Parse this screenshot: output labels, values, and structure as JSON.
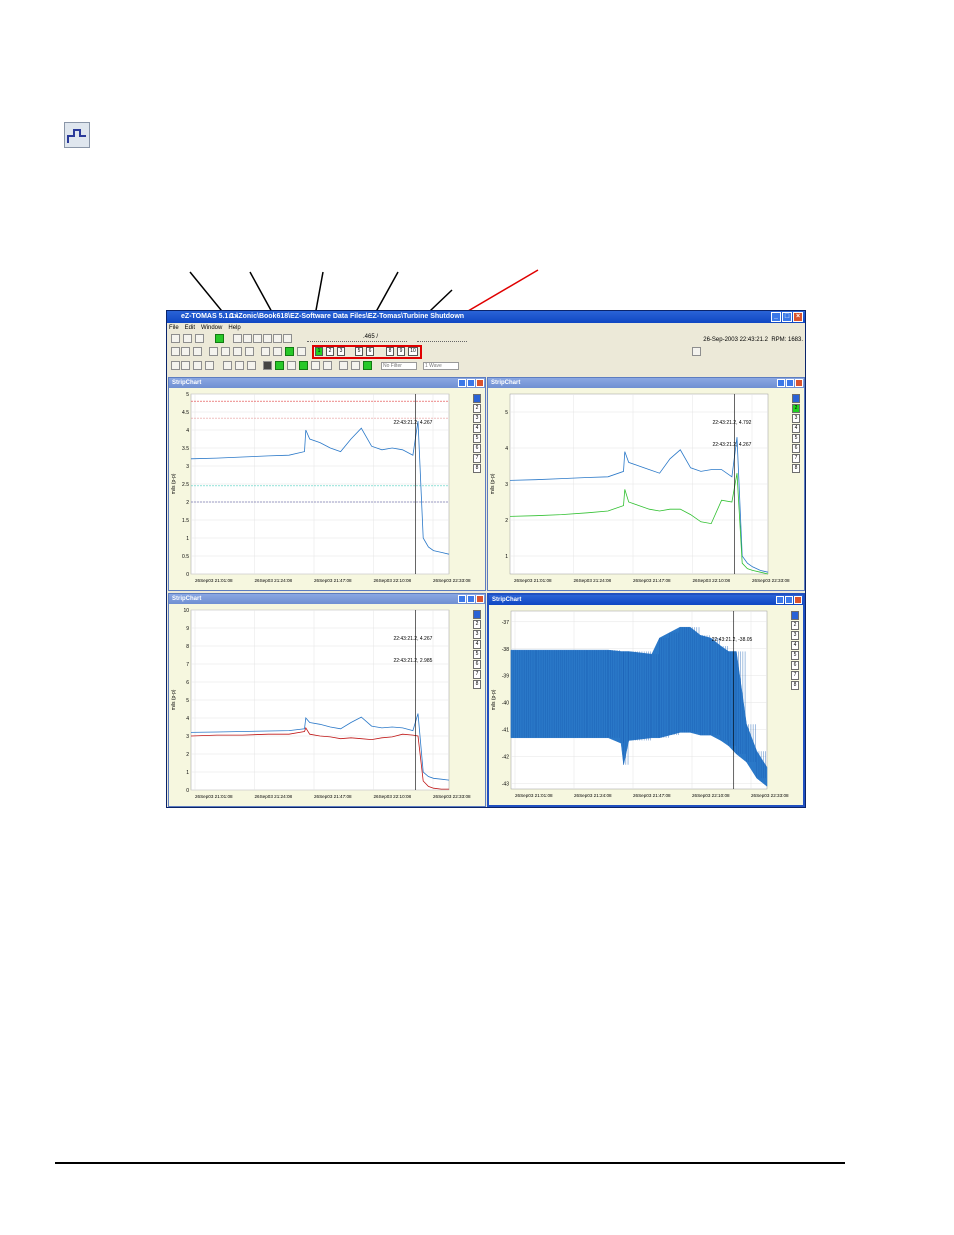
{
  "app": {
    "title": "eZ-TOMAS 5.1.1x",
    "path": "C:\\Zonic\\Book618\\EZ-Software Data Files\\EZ-Tomas\\Turbine Shutdown",
    "menu": [
      "File",
      "Edit",
      "Window",
      "Help"
    ],
    "timestamp": "26-Sep-2003 22:43:21.2",
    "rpm": "RPM: 1683.",
    "playback_value": ".465 /",
    "channels": [
      "1",
      "2",
      "3",
      "4",
      "5",
      "6",
      "7",
      "8",
      "9",
      "10"
    ],
    "filter_select": "No Filter",
    "wave_select": "1 Wave",
    "colors": {
      "accent": "#2a63d6",
      "highlight": "#e00000",
      "active_channel": "#1fd11f"
    }
  },
  "windows": [
    {
      "title": "StripChart",
      "channels": [
        "1",
        "2",
        "3",
        "4",
        "5",
        "6",
        "7",
        "8"
      ],
      "active": [
        1
      ]
    },
    {
      "title": "StripChart",
      "channels": [
        "1",
        "2",
        "3",
        "4",
        "5",
        "6",
        "7",
        "8"
      ],
      "active": [
        1,
        2
      ]
    },
    {
      "title": "StripChart",
      "channels": [
        "1",
        "2",
        "3",
        "4",
        "5",
        "6",
        "7",
        "8"
      ],
      "active": [
        1
      ]
    },
    {
      "title": "StripChart",
      "channels": [
        "1",
        "2",
        "3",
        "4",
        "5",
        "6",
        "7",
        "8"
      ],
      "active": [
        1
      ],
      "focused": true
    }
  ],
  "chart_data": [
    {
      "type": "line",
      "title": "StripChart",
      "xlabel": "",
      "ylabel": "mils (p-p)",
      "ylim": [
        0,
        5
      ],
      "yticks": [
        "0",
        "0.5",
        "1",
        "1.5",
        "2",
        "2.5",
        "3",
        "3.5",
        "4",
        "4.5",
        "5"
      ],
      "xticks": [
        "26Sep03 21:01:08",
        "26Sep03 21:24:08",
        "26Sep03 21:47:08",
        "26Sep03 22:10:08",
        "26Sep03 22:33:08"
      ],
      "cursor_label": "22:43:21.2, 4.267",
      "grid": true,
      "reference_lines": [
        {
          "y": 4.8,
          "color": "#e04040"
        },
        {
          "y": 4.33,
          "color": "#e08080"
        },
        {
          "y": 2.45,
          "color": "#50d0c0"
        },
        {
          "y": 2.0,
          "color": "#404090"
        }
      ],
      "series": [
        {
          "color": "#2a78c8",
          "x": [
            0,
            0.1,
            0.2,
            0.3,
            0.38,
            0.44,
            0.445,
            0.46,
            0.5,
            0.54,
            0.58,
            0.62,
            0.66,
            0.7,
            0.74,
            0.78,
            0.82,
            0.86,
            0.88,
            0.9,
            0.92,
            0.94,
            0.97,
            1.0
          ],
          "values": [
            3.2,
            3.22,
            3.25,
            3.28,
            3.3,
            3.4,
            4.0,
            3.75,
            3.65,
            3.5,
            3.4,
            3.75,
            4.05,
            3.55,
            3.45,
            3.5,
            3.45,
            3.3,
            4.25,
            1.0,
            0.75,
            0.65,
            0.6,
            0.55
          ]
        }
      ]
    },
    {
      "type": "line",
      "title": "StripChart",
      "xlabel": "",
      "ylabel": "mils (p-p)",
      "ylim": [
        0.5,
        5.5
      ],
      "yticks": [
        "1",
        "2",
        "3",
        "4",
        "5"
      ],
      "xticks": [
        "26Sep03 21:01:08",
        "26Sep03 21:24:08",
        "26Sep03 21:47:08",
        "26Sep03 22:10:08",
        "26Sep03 22:33:08"
      ],
      "cursor_labels": [
        "22:43:21.2, 4.792",
        "22:43:21.2, 4.267"
      ],
      "grid": true,
      "series": [
        {
          "color": "#2a78c8",
          "x": [
            0,
            0.1,
            0.2,
            0.3,
            0.38,
            0.44,
            0.445,
            0.46,
            0.5,
            0.54,
            0.58,
            0.62,
            0.66,
            0.7,
            0.74,
            0.78,
            0.82,
            0.86,
            0.88,
            0.9,
            0.92,
            0.94,
            0.97,
            1.0
          ],
          "values": [
            3.1,
            3.12,
            3.15,
            3.18,
            3.2,
            3.35,
            3.9,
            3.6,
            3.5,
            3.4,
            3.3,
            3.7,
            3.95,
            3.45,
            3.35,
            3.4,
            3.4,
            3.2,
            4.3,
            1.0,
            0.8,
            0.7,
            0.6,
            0.55
          ]
        },
        {
          "color": "#30c030",
          "x": [
            0,
            0.1,
            0.2,
            0.3,
            0.38,
            0.44,
            0.445,
            0.46,
            0.5,
            0.54,
            0.58,
            0.62,
            0.66,
            0.7,
            0.74,
            0.78,
            0.82,
            0.86,
            0.88,
            0.9,
            0.92,
            0.94,
            0.97,
            1.0
          ],
          "values": [
            2.1,
            2.12,
            2.15,
            2.2,
            2.25,
            2.4,
            2.85,
            2.5,
            2.4,
            2.3,
            2.25,
            2.3,
            2.3,
            2.15,
            1.95,
            1.9,
            2.55,
            2.5,
            3.3,
            0.8,
            0.65,
            0.6,
            0.55,
            0.5
          ]
        }
      ]
    },
    {
      "type": "line",
      "title": "StripChart",
      "xlabel": "",
      "ylabel": "mils (p-p)",
      "ylim": [
        0,
        10
      ],
      "yticks": [
        "0",
        "1",
        "2",
        "3",
        "4",
        "5",
        "6",
        "7",
        "8",
        "9",
        "10"
      ],
      "xticks": [
        "26Sep03 21:01:08",
        "26Sep03 21:24:08",
        "26Sep03 21:47:08",
        "26Sep03 22:10:08",
        "26Sep03 22:33:08"
      ],
      "cursor_labels": [
        "22:43:21.2, 4.267",
        "22:43:21.2, 2.985"
      ],
      "grid": true,
      "series": [
        {
          "color": "#2a78c8",
          "x": [
            0,
            0.1,
            0.2,
            0.3,
            0.38,
            0.44,
            0.445,
            0.46,
            0.5,
            0.54,
            0.58,
            0.62,
            0.66,
            0.7,
            0.74,
            0.78,
            0.82,
            0.86,
            0.88,
            0.9,
            0.92,
            0.94,
            0.97,
            1.0
          ],
          "values": [
            3.2,
            3.22,
            3.25,
            3.28,
            3.3,
            3.4,
            4.0,
            3.75,
            3.65,
            3.5,
            3.4,
            3.75,
            4.05,
            3.55,
            3.45,
            3.5,
            3.45,
            3.3,
            4.25,
            1.0,
            0.75,
            0.65,
            0.6,
            0.55
          ]
        },
        {
          "color": "#c01818",
          "x": [
            0,
            0.1,
            0.2,
            0.3,
            0.38,
            0.44,
            0.445,
            0.46,
            0.5,
            0.54,
            0.58,
            0.62,
            0.66,
            0.7,
            0.74,
            0.78,
            0.82,
            0.86,
            0.88,
            0.9,
            0.92,
            0.94,
            0.97,
            1.0
          ],
          "values": [
            3.0,
            3.05,
            3.05,
            3.1,
            3.1,
            3.25,
            3.45,
            3.1,
            3.0,
            2.95,
            2.85,
            2.9,
            2.85,
            2.8,
            2.9,
            2.95,
            3.1,
            3.05,
            3.0,
            0.5,
            0.2,
            0.1,
            0.05,
            0.05
          ]
        }
      ]
    },
    {
      "type": "line",
      "title": "StripChart",
      "xlabel": "",
      "ylabel": "mils (p-p)",
      "ylim": [
        -43.2,
        -36.6
      ],
      "yticks": [
        "-43",
        "-42",
        "-41",
        "-40",
        "-39",
        "-38",
        "-37"
      ],
      "xticks": [
        "26Sep03 21:01:08",
        "26Sep03 21:24:08",
        "26Sep03 21:47:08",
        "26Sep03 22:10:08",
        "26Sep03 22:33:08"
      ],
      "cursor_label": "22:43:21.2, -38.05",
      "grid": true,
      "series": [
        {
          "color": "#2a78c8",
          "style": "band",
          "x": [
            0,
            0.1,
            0.2,
            0.3,
            0.38,
            0.43,
            0.44,
            0.46,
            0.55,
            0.58,
            0.62,
            0.66,
            0.7,
            0.74,
            0.78,
            0.82,
            0.85,
            0.88,
            0.92,
            0.96,
            1.0
          ],
          "upper": [
            -38.05,
            -38.05,
            -38.05,
            -38.05,
            -38.05,
            -38.1,
            -38.1,
            -38.1,
            -38.2,
            -37.6,
            -37.4,
            -37.2,
            -37.2,
            -37.5,
            -37.6,
            -37.9,
            -38.1,
            -38.1,
            -40.8,
            -41.8,
            -42.4
          ],
          "lower": [
            -41.3,
            -41.3,
            -41.3,
            -41.3,
            -41.3,
            -41.5,
            -42.3,
            -41.4,
            -41.3,
            -41.3,
            -41.2,
            -41.1,
            -41.1,
            -41.2,
            -41.2,
            -41.4,
            -41.6,
            -41.9,
            -42.2,
            -42.8,
            -43.1
          ]
        }
      ]
    }
  ]
}
